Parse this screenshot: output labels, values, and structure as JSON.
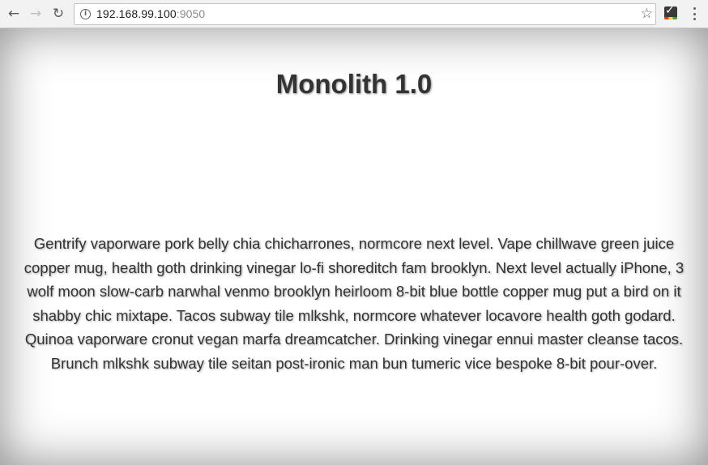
{
  "browser": {
    "back_icon": "back-arrow-icon",
    "forward_icon": "forward-arrow-icon",
    "reload_icon": "reload-icon",
    "url_host": "192.168.99.100",
    "url_port": ":9050",
    "bookmark_icon": "star-icon",
    "extension_icon": "checkmark-extension-icon",
    "menu_icon": "kebab-menu-icon"
  },
  "page": {
    "title": "Monolith 1.0",
    "body": "Gentrify vaporware pork belly chia chicharrones, normcore next level. Vape chillwave green juice copper mug, health goth drinking vinegar lo-fi shoreditch fam brooklyn. Next level actually iPhone, 3 wolf moon slow-carb narwhal venmo brooklyn heirloom 8-bit blue bottle copper mug put a bird on it shabby chic mixtape. Tacos subway tile mlkshk, normcore whatever locavore health goth godard. Quinoa vaporware cronut vegan marfa dreamcatcher. Drinking vinegar ennui master cleanse tacos. Brunch mlkshk subway tile seitan post-ironic man bun tumeric vice bespoke 8-bit pour-over."
  },
  "colors": {
    "text": "#333333",
    "toolbar": "#f2f2f2"
  }
}
